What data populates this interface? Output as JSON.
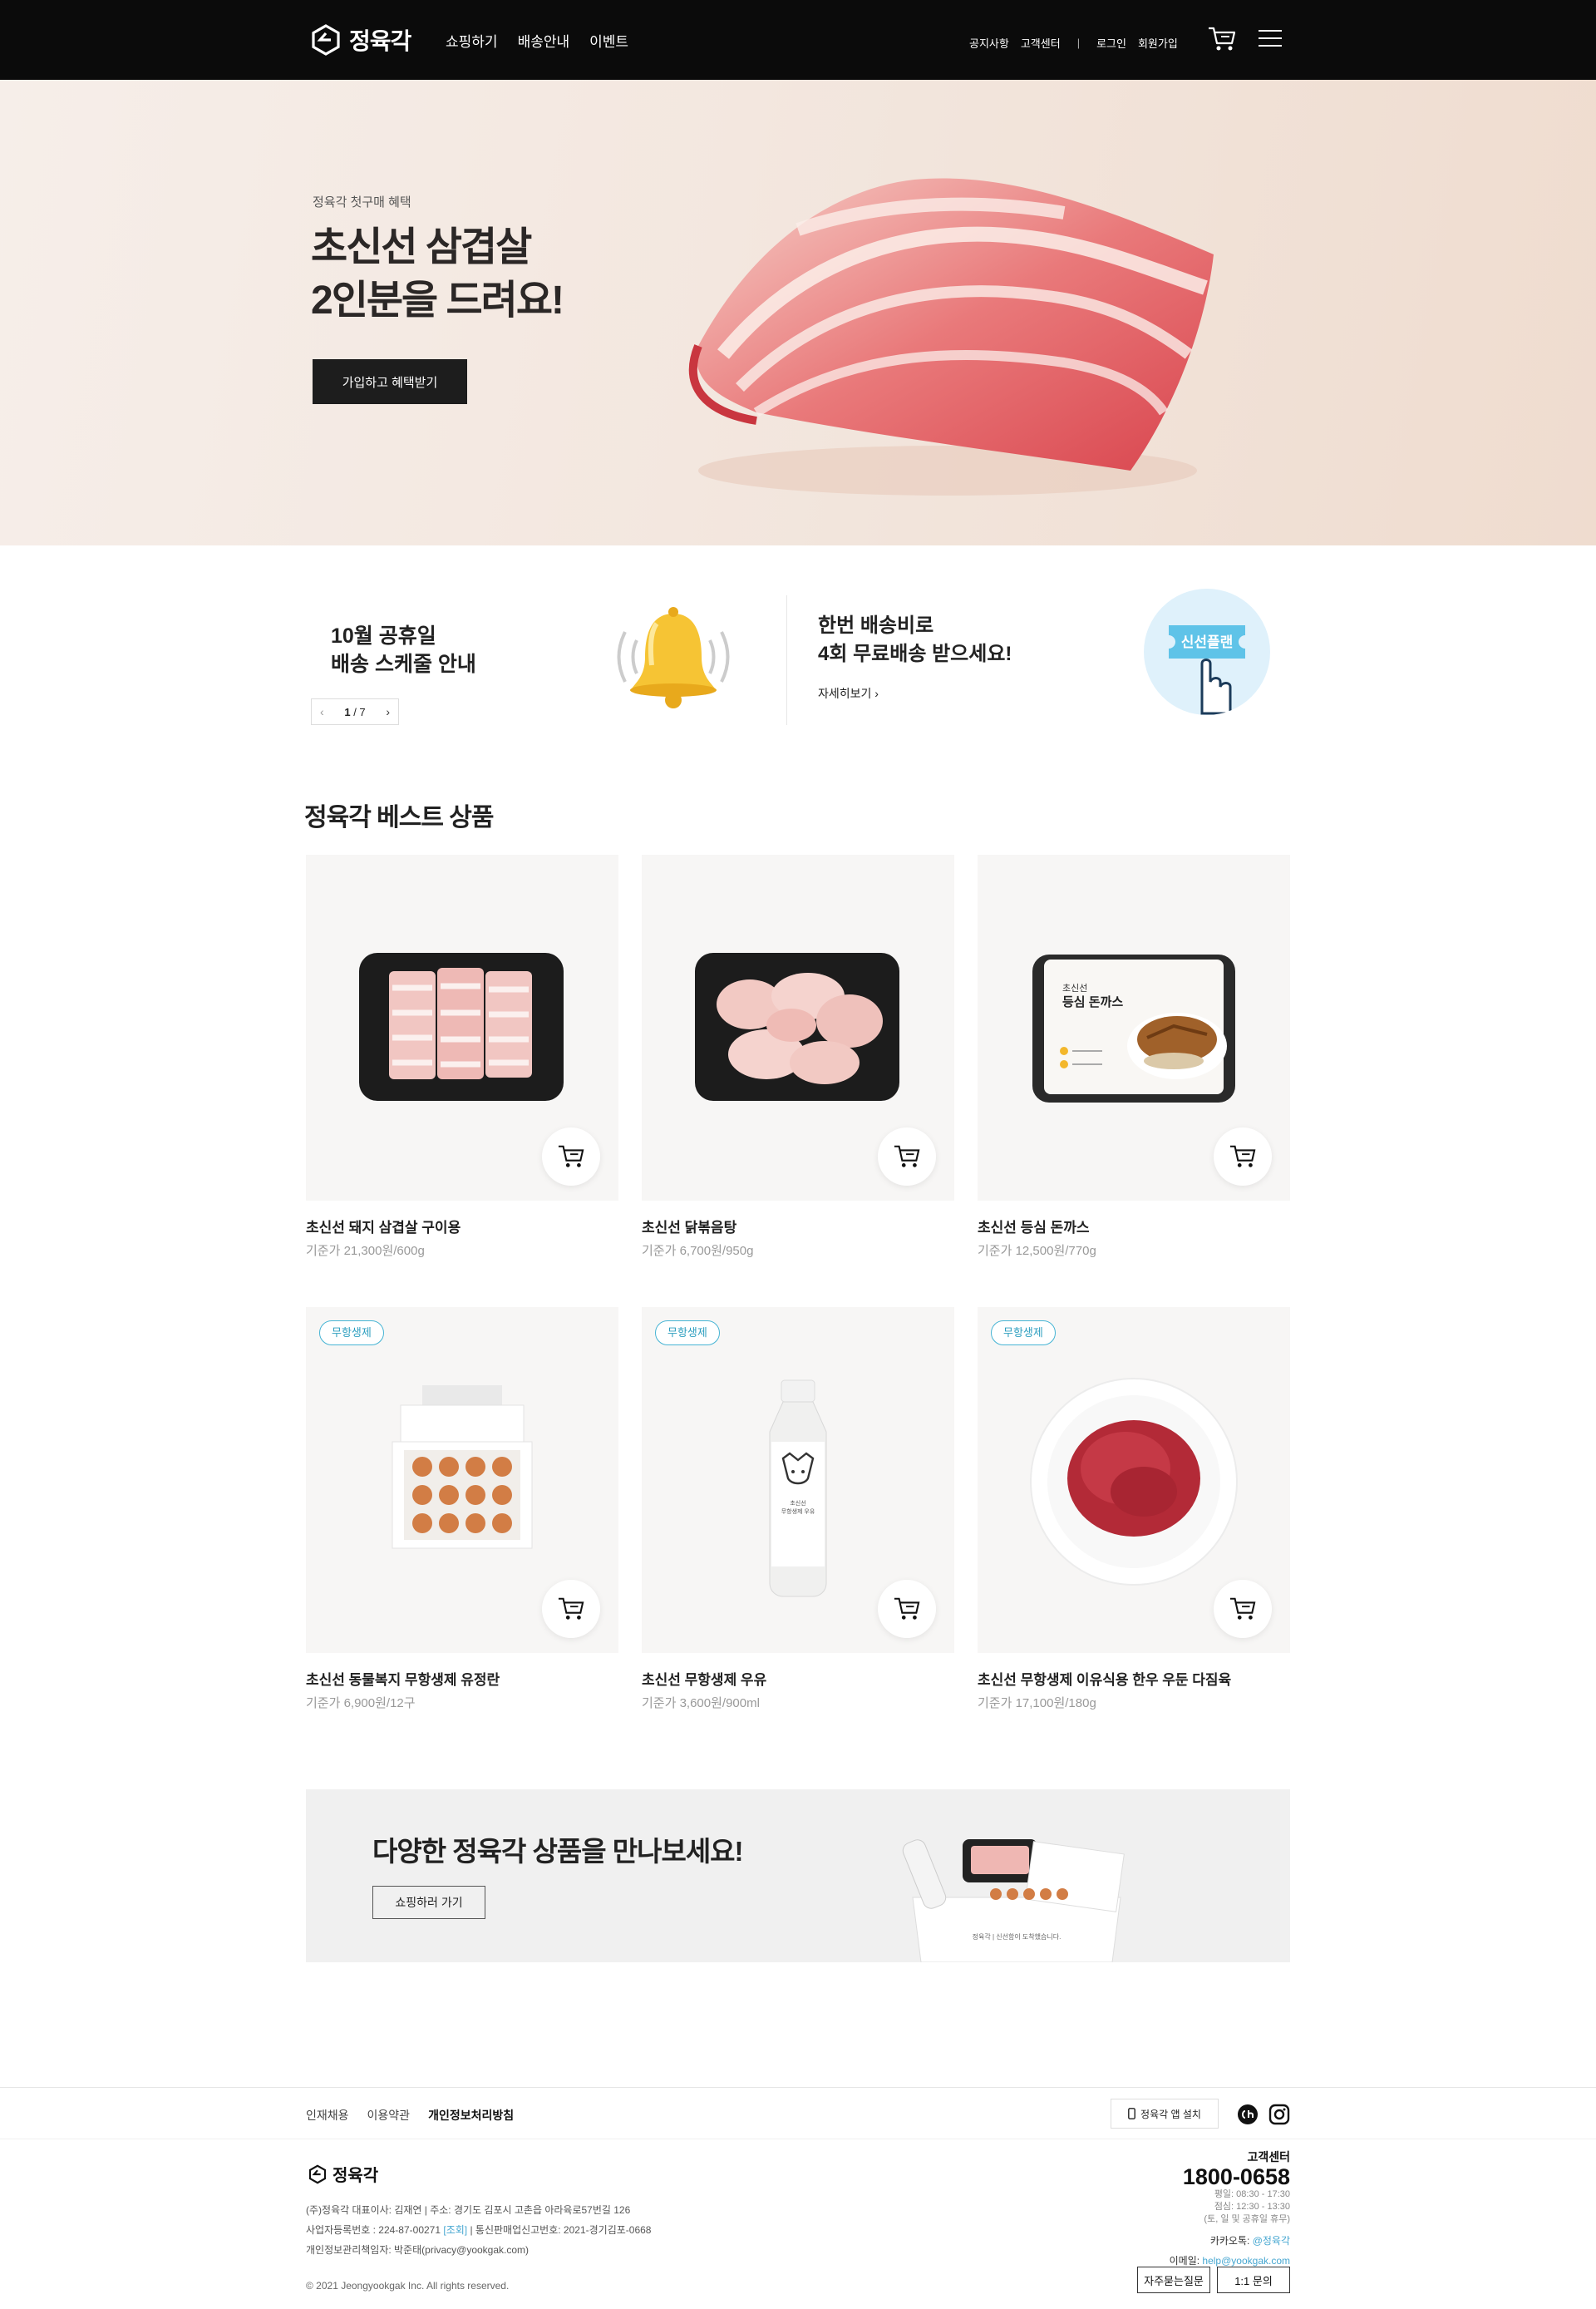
{
  "header": {
    "brand": "정육각",
    "nav": [
      "쇼핑하기",
      "배송안내",
      "이벤트"
    ],
    "util": {
      "notice": "공지사항",
      "cs": "고객센터",
      "sep": "|",
      "login": "로그인",
      "signup": "회원가입"
    }
  },
  "hero": {
    "eyebrow": "정육각 첫구매 혜택",
    "title": "초신선 삼겹살\n2인분을 드려요!",
    "cta": "가입하고 혜택받기"
  },
  "info": {
    "left_title": "10월 공휴일\n배송 스케줄 안내",
    "pager": {
      "current": "1",
      "total": "7",
      "prev": "‹",
      "next": "›"
    },
    "right_title": "한번 배송비로\n4회 무료배송 받으세요!",
    "right_link": "자세히보기",
    "plan_label": "신선플랜"
  },
  "best": {
    "title": "정육각 베스트 상품",
    "products": [
      {
        "name": "초신선 돼지 삼겹살 구이용",
        "price": "기준가 21,300원/600g",
        "badge": ""
      },
      {
        "name": "초신선 닭볶음탕",
        "price": "기준가 6,700원/950g",
        "badge": ""
      },
      {
        "name": "초신선 등심 돈까스",
        "price": "기준가 12,500원/770g",
        "badge": ""
      },
      {
        "name": "초신선 동물복지 무항생제 유정란",
        "price": "기준가 6,900원/12구",
        "badge": "무항생제"
      },
      {
        "name": "초신선 무항생제 우유",
        "price": "기준가 3,600원/900ml",
        "badge": "무항생제"
      },
      {
        "name": "초신선 무항생제 이유식용 한우 우둔 다짐육",
        "price": "기준가 17,100원/180g",
        "badge": "무항생제"
      }
    ],
    "tonkatsu_pack": {
      "line1": "초신선",
      "line2": "등심 돈까스"
    },
    "milk_label": {
      "line1": "초신선",
      "line2": "무항생제 우유"
    }
  },
  "banner": {
    "title": "다양한 정육각 상품을 만나보세요!",
    "button": "쇼핑하러 가기",
    "bag_text": "정육각 | 신선함이 도착했습니다."
  },
  "footer": {
    "links": [
      "인재채용",
      "이용약관",
      "개인정보처리방침"
    ],
    "app_button": "정육각 앱 설치",
    "brand": "정육각",
    "company": "(주)정육각   대표이사: 김재연  |  주소: 경기도 김포시 고촌읍 아라육로57번길 126",
    "biz_reg": "사업자등록번호 : 224-87-00271",
    "biz_check": "[조회]",
    "mail_order": "통신판매업신고번호: 2021-경기김포-0668",
    "privacy_officer": "개인정보관리책임자: 박준태(privacy@yookgak.com)",
    "copyright": "© 2021 Jeongyookgak Inc. All rights reserved.",
    "cs_label": "고객센터",
    "cs_phone": "1800-0658",
    "cs_hours": "평일: 08:30 - 17:30\n점심: 12:30 - 13:30\n(토, 일 및 공휴일 휴무)",
    "kakao_label": "카카오톡:",
    "kakao_value": "@정육각",
    "email_label": "이메일:",
    "email_value": "help@yookgak.com",
    "faq_button": "자주묻는질문",
    "inquiry_button": "1:1 문의"
  },
  "colors": {
    "header_bg": "#0b0b0b",
    "accent_blue": "#46b4d4",
    "cta_dark": "#1d1d1d"
  }
}
